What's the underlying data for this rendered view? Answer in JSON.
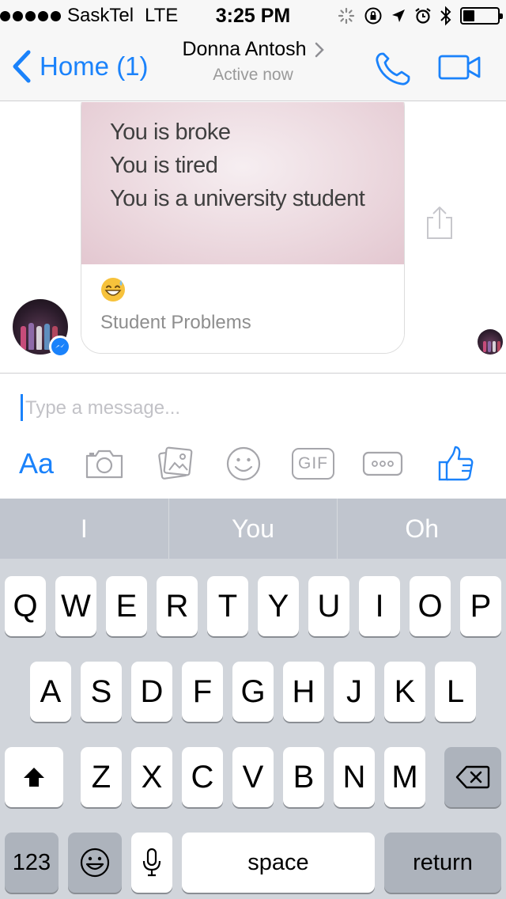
{
  "status_bar": {
    "carrier": "SaskTel",
    "network": "LTE",
    "time": "3:25 PM"
  },
  "nav": {
    "back_label": "Home (1)",
    "contact_name": "Donna Antosh",
    "contact_status": "Active now",
    "accent_color": "#1a82fb"
  },
  "message": {
    "card_lines": [
      "You is broke",
      "You is tired",
      "You is a university student"
    ],
    "emoji": "grinning-face-with-sweat",
    "source": "Student Problems"
  },
  "composer": {
    "placeholder": "Type a message...",
    "value": "",
    "aa_label": "Aa",
    "gif_label": "GIF"
  },
  "keyboard": {
    "suggestions": [
      "I",
      "You",
      "Oh"
    ],
    "row1": [
      "Q",
      "W",
      "E",
      "R",
      "T",
      "Y",
      "U",
      "I",
      "O",
      "P"
    ],
    "row2": [
      "A",
      "S",
      "D",
      "F",
      "G",
      "H",
      "J",
      "K",
      "L"
    ],
    "row3": [
      "Z",
      "X",
      "C",
      "V",
      "B",
      "N",
      "M"
    ],
    "numbers_label": "123",
    "space_label": "space",
    "return_label": "return"
  }
}
